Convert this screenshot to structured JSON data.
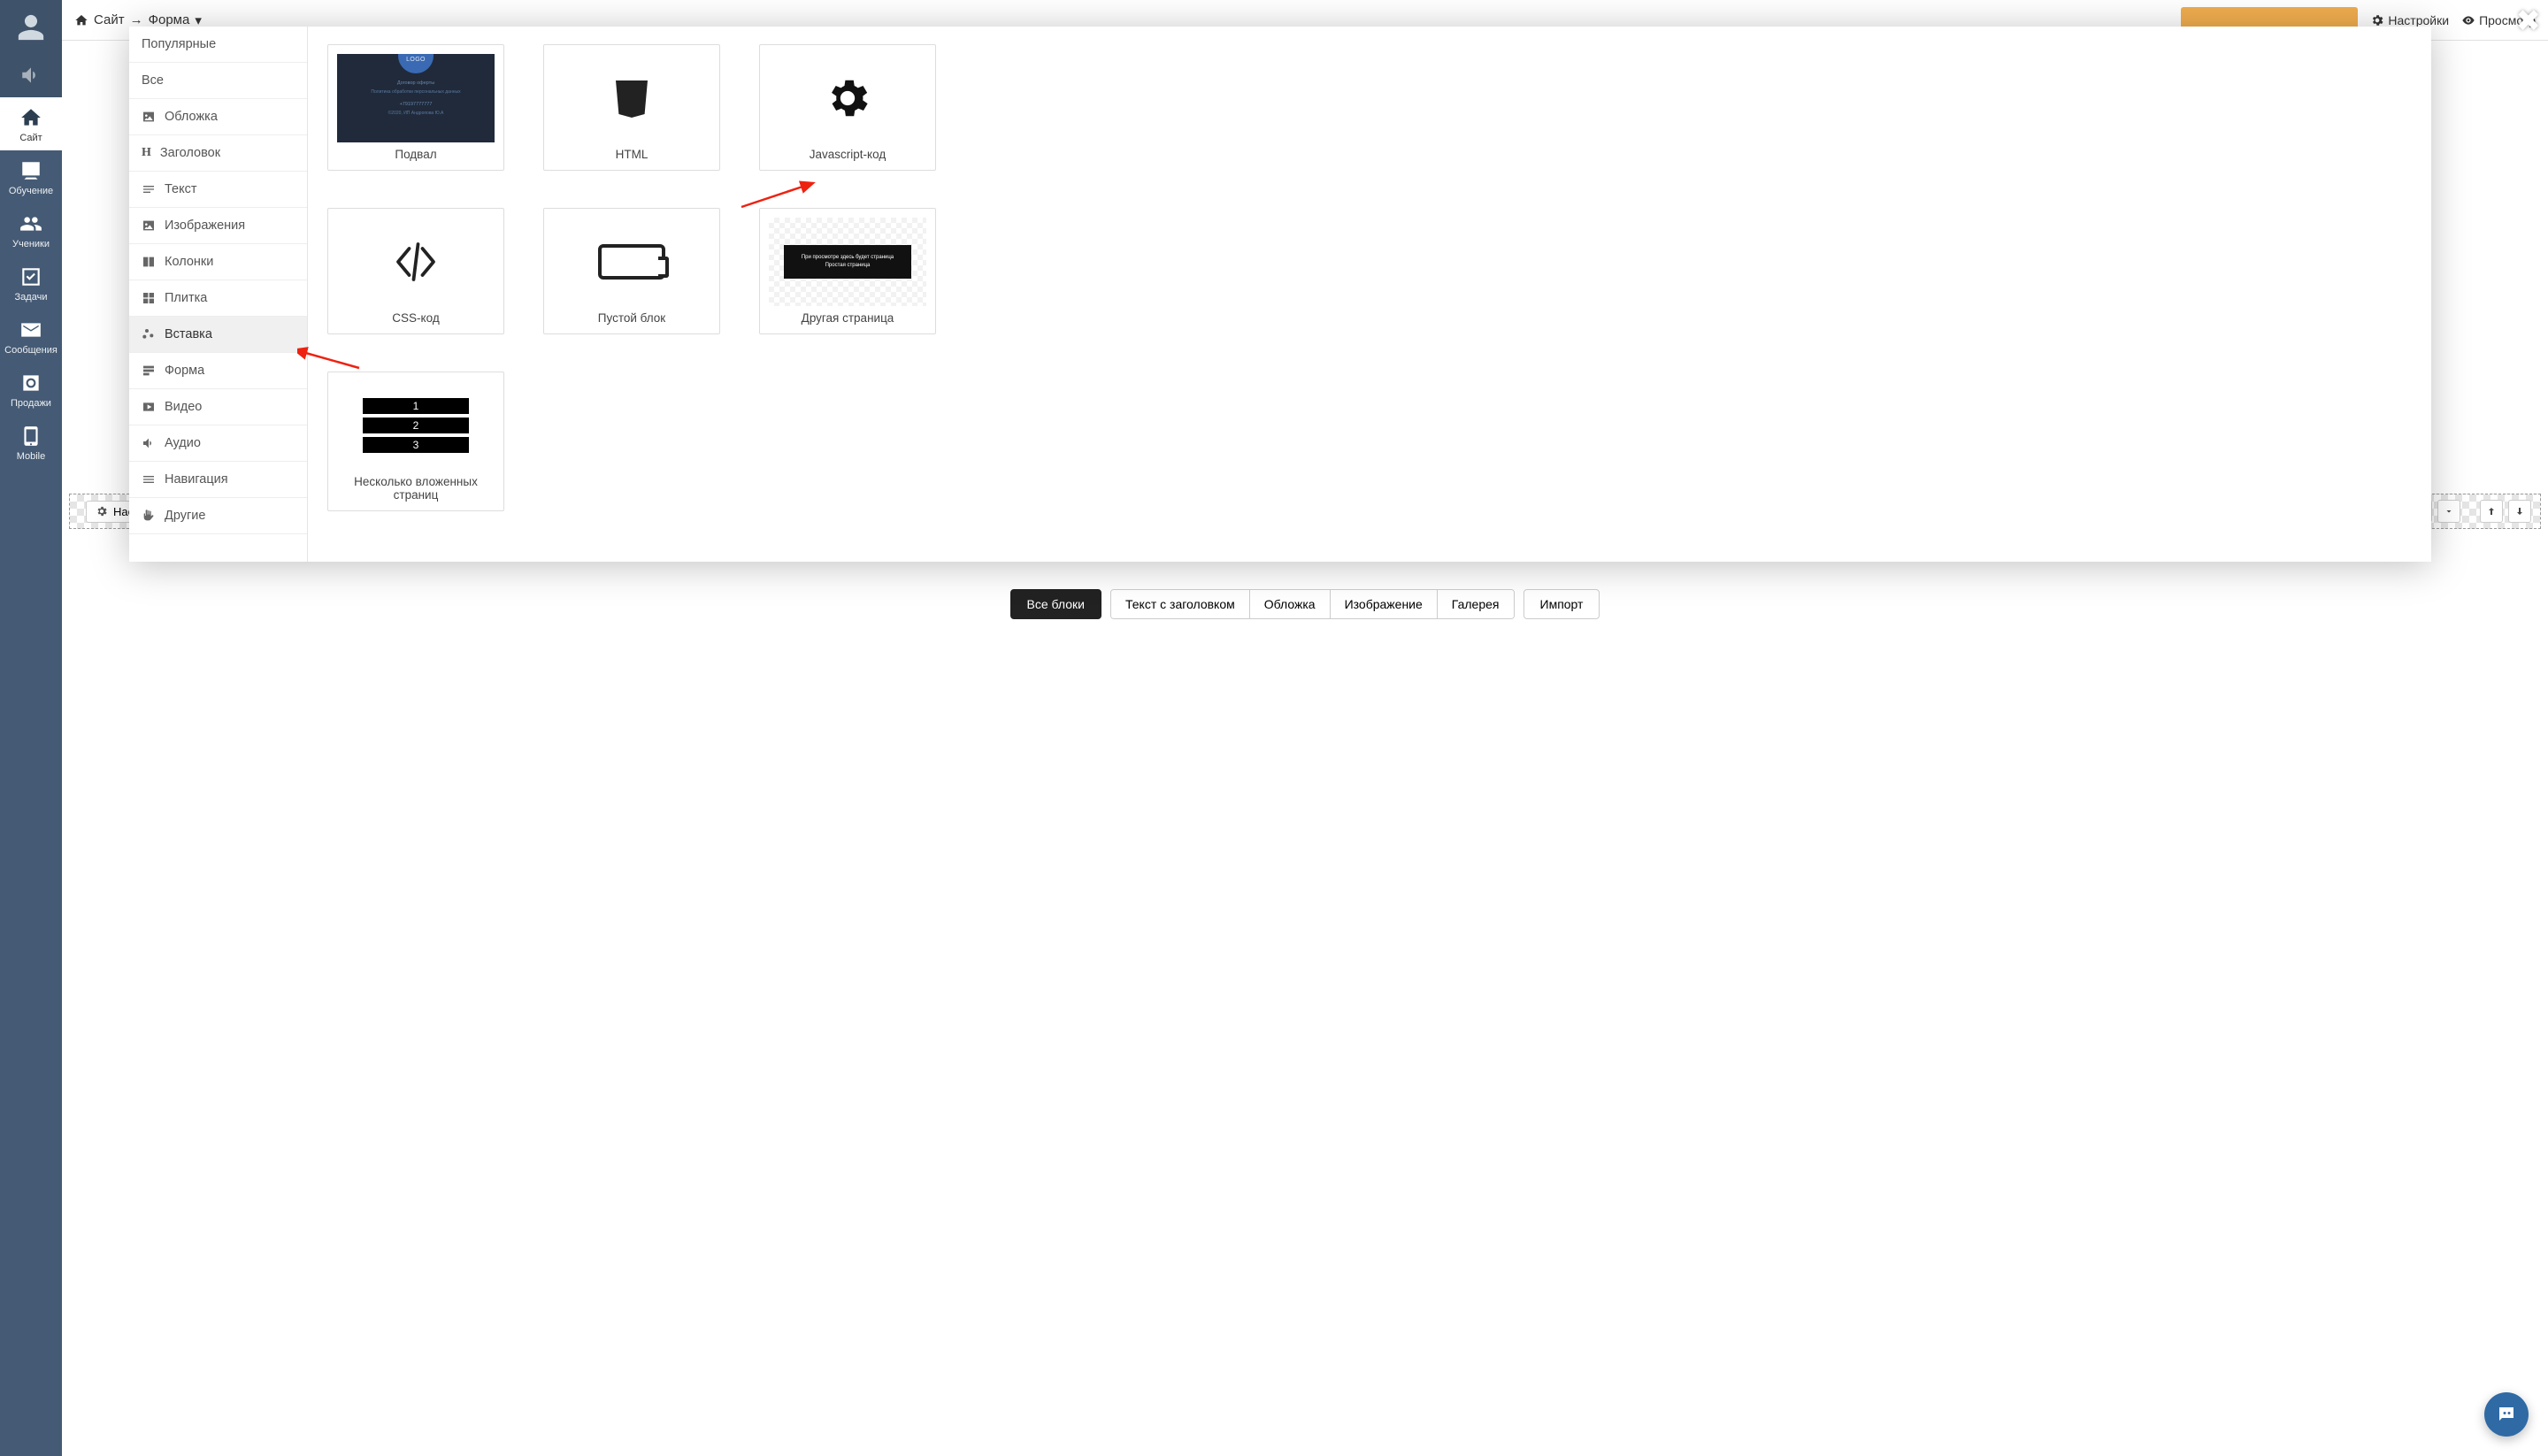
{
  "topbar": {
    "crumb1": "Сайт",
    "crumb2": "Форма",
    "arrow": "→",
    "caret": "▾",
    "settings": "Настройки",
    "preview": "Просмотр"
  },
  "sidebar": {
    "items": [
      {
        "key": "avatar",
        "label": ""
      },
      {
        "key": "sound",
        "label": ""
      },
      {
        "key": "site",
        "label": "Сайт"
      },
      {
        "key": "learn",
        "label": "Обучение"
      },
      {
        "key": "students",
        "label": "Ученики"
      },
      {
        "key": "tasks",
        "label": "Задачи"
      },
      {
        "key": "messages",
        "label": "Сообщения"
      },
      {
        "key": "sales",
        "label": "Продажи"
      },
      {
        "key": "mobile",
        "label": "Mobile"
      }
    ]
  },
  "checker": {
    "settings": "Настройка"
  },
  "bottomButtons": {
    "allBlocks": "Все блоки",
    "textHead": "Текст с заголовком",
    "cover": "Обложка",
    "image": "Изображение",
    "gallery": "Галерея",
    "import": "Импорт"
  },
  "modal": {
    "categories": {
      "popular": "Популярные",
      "all": "Все",
      "cover": "Обложка",
      "heading": "Заголовок",
      "text": "Текст",
      "images": "Изображения",
      "columns": "Колонки",
      "tiles": "Плитка",
      "insert": "Вставка",
      "form": "Форма",
      "video": "Видео",
      "audio": "Аудио",
      "nav": "Навигация",
      "other": "Другие"
    },
    "blocks": {
      "footer": "Подвал",
      "html": "HTML",
      "js": "Javascript-код",
      "css": "CSS-код",
      "empty": "Пустой блок",
      "otherPage": "Другая страница",
      "nested": "Несколько вложенных страниц",
      "footerThumb": {
        "logoText": "LOGO",
        "line1": "Договор оферты",
        "line2": "Политика обработки персональных данных",
        "phone": "+79197777777",
        "copyright": "©2020, ИП Андропова Ю.А"
      },
      "otherPageThumb": {
        "hint": "При просмотре здесь будет страница",
        "title": "Простая страница"
      },
      "nestedThumb": {
        "r1": "1",
        "r2": "2",
        "r3": "3"
      }
    }
  }
}
